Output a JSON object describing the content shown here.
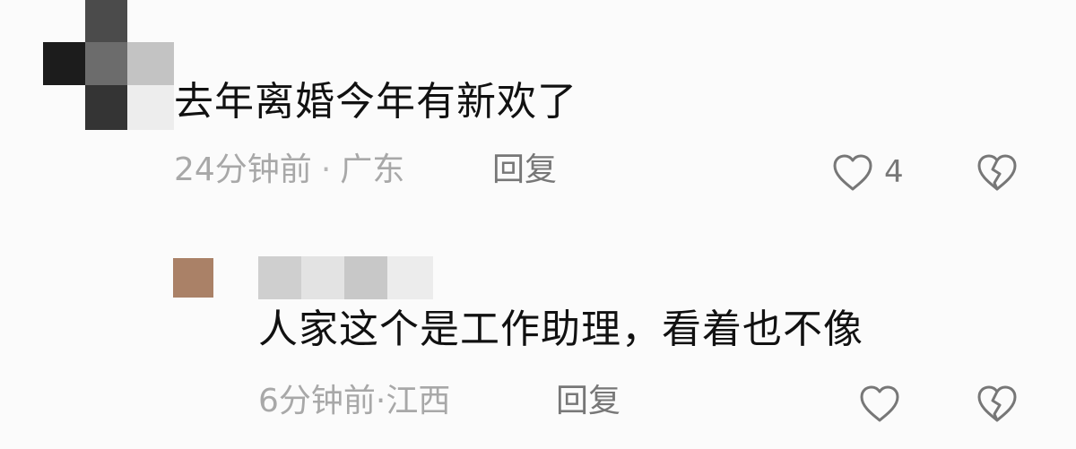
{
  "comment_1": {
    "text": "去年离婚今年有新欢了",
    "time": "24分钟前",
    "separator": "·",
    "location": "广东",
    "reply_label": "回复",
    "like_count": "4",
    "like_icon": "heart-outline-icon",
    "dislike_icon": "broken-heart-icon"
  },
  "reply_1": {
    "text": "人家这个是工作助理，看着也不像",
    "time": "6分钟前",
    "separator": "·",
    "location": "江西",
    "reply_label": "回复",
    "like_icon": "heart-outline-icon",
    "dislike_icon": "broken-heart-icon"
  },
  "colors": {
    "background": "#fbfbfb",
    "primary_text": "#111111",
    "meta_text": "#a8a8a8",
    "action_text": "#777777",
    "avatar_reply": "#aa8167"
  }
}
